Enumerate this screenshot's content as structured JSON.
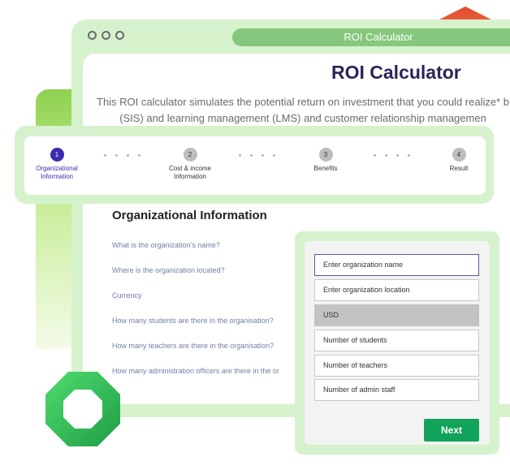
{
  "window": {
    "title": "ROI Calculator"
  },
  "page": {
    "title": "ROI Calculator",
    "intro_line1": "This ROI calculator simulates the potential return on investment that you could realize* b",
    "intro_line2": "(SIS) and learning management (LMS) and customer relationship managemen"
  },
  "stepper": {
    "steps": [
      {
        "number": "1",
        "label_line1": "Organizational",
        "label_line2": "Information",
        "active": true
      },
      {
        "number": "2",
        "label_line1": "Cost & income",
        "label_line2": "Information",
        "active": false
      },
      {
        "number": "3",
        "label_line1": "Benefits",
        "label_line2": "",
        "active": false
      },
      {
        "number": "4",
        "label_line1": "Result",
        "label_line2": "",
        "active": false
      }
    ]
  },
  "section": {
    "title": "Organizational Information",
    "questions": [
      "What is the organization’s name?",
      "Where is the organization located?",
      "Currency",
      "How many students are there in the organisation?",
      "How many teachers are there in the organisation?",
      "How many administration officers are there in the or"
    ]
  },
  "form": {
    "fields": [
      {
        "placeholder": "Enter organization name"
      },
      {
        "placeholder": "Enter organization location"
      },
      {
        "value": "USD"
      },
      {
        "placeholder": "Number of students"
      },
      {
        "placeholder": "Number of teachers"
      },
      {
        "placeholder": "Number of admin staff"
      }
    ],
    "next_label": "Next"
  },
  "colors": {
    "accent_green": "#12a35b",
    "frame_green": "#d6f2cd",
    "active_step": "#3b2bb0",
    "title_navy": "#2a2558"
  }
}
